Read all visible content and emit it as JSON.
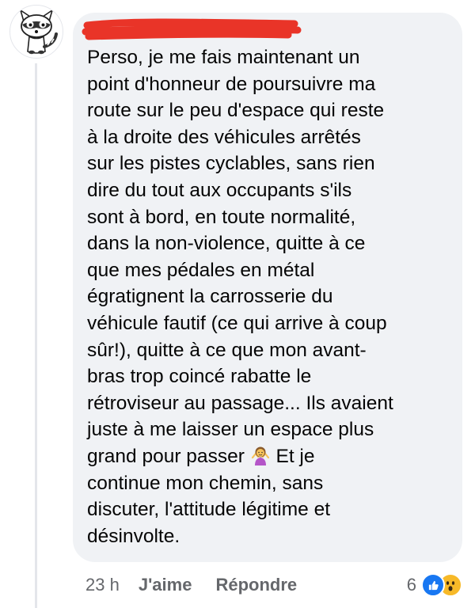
{
  "comment": {
    "author_name": "",
    "text": "Perso, je me fais maintenant un\npoint d'honneur de poursuivre ma\nroute sur le peu d'espace qui reste\nà la droite des véhicules arrêtés\nsur les pistes cyclables, sans rien\ndire du tout aux occupants s'ils\nsont à bord, en toute normalité,\ndans la non-violence, quitte à ce\nque mes pédales en métal\négratignent la carrosserie du\nvéhicule fautif (ce qui arrive à coup\nsûr!), quitte à ce que mon avant-\nbras trop coincé rabatte le\nrétroviseur au passage... Ils avaient\njuste à me laisser un espace plus\ngrand pour passer",
    "text_after_emoji": " Et je\ncontinue mon chemin, sans\ndiscuter, l'attitude légitime et\ndésinvolte.",
    "emoji": "person-shrugging-icon"
  },
  "actions": {
    "timestamp": "23 h",
    "like_label": "J'aime",
    "reply_label": "Répondre"
  },
  "reactions": {
    "count": "6",
    "types": [
      "like-icon",
      "wow-icon"
    ]
  },
  "colors": {
    "bubble_bg": "#f0f2f5",
    "meta_text": "#65676b",
    "like_blue": "#1877f2",
    "wow_yellow": "#f7b928",
    "redaction_red": "#e8291c"
  }
}
